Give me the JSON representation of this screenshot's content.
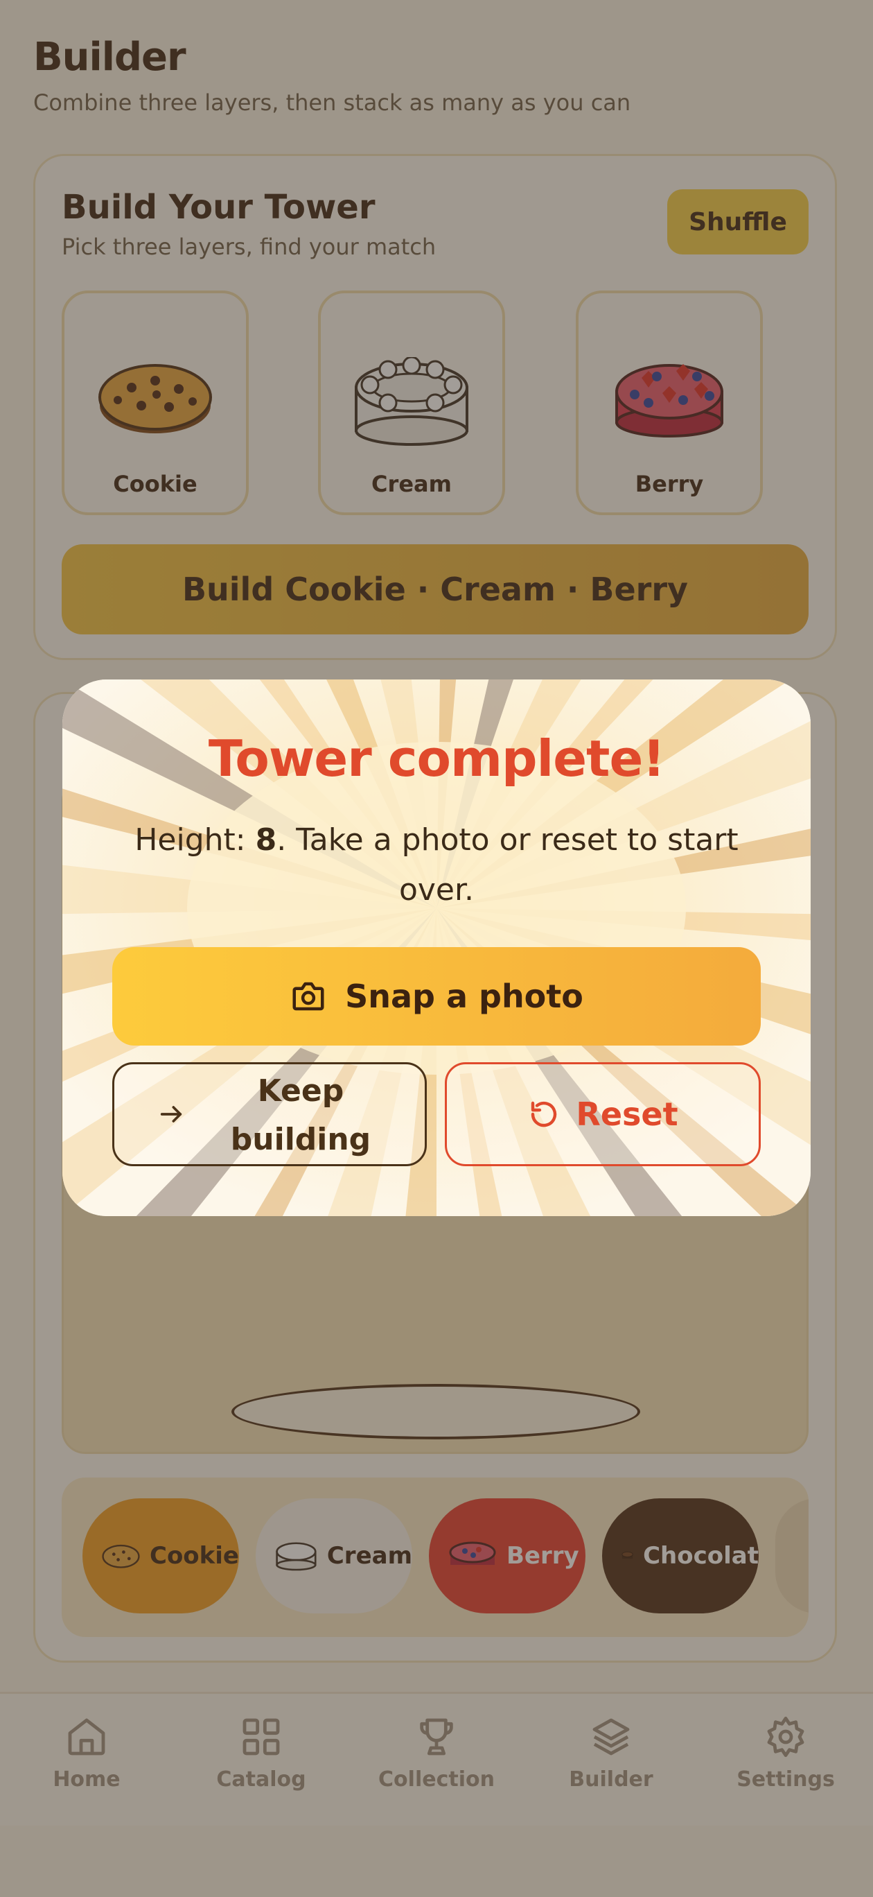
{
  "page": {
    "title": "Builder",
    "subtitle": "Combine three layers, then stack as many as you can"
  },
  "build_card": {
    "title": "Build Your Tower",
    "subtitle": "Pick three layers, find your match",
    "shuffle_label": "Shuffle",
    "layers": [
      {
        "label": "Cookie",
        "icon": "cookie-icon"
      },
      {
        "label": "Cream",
        "icon": "cream-icon"
      },
      {
        "label": "Berry",
        "icon": "berry-icon"
      }
    ],
    "build_label": "Build Cookie · Cream · Berry"
  },
  "chips": [
    {
      "label": "Cookie",
      "icon": "cookie-icon",
      "bg": "#ef9a1e",
      "fg": "#3b2210"
    },
    {
      "label": "Cream",
      "icon": "cream-icon",
      "bg": "#f6f1e8",
      "fg": "#3b2210"
    },
    {
      "label": "Berry",
      "icon": "berry-icon",
      "bg": "#e53b2d",
      "fg": "#ffffff"
    },
    {
      "label": "Chocolat",
      "icon": "chocolate-icon",
      "bg": "#4a2a14",
      "fg": "#ffffff"
    }
  ],
  "nav": [
    {
      "label": "Home",
      "icon": "home-icon"
    },
    {
      "label": "Catalog",
      "icon": "grid-icon"
    },
    {
      "label": "Collection",
      "icon": "trophy-icon"
    },
    {
      "label": "Builder",
      "icon": "layers-icon"
    },
    {
      "label": "Settings",
      "icon": "gear-icon"
    }
  ],
  "modal": {
    "title": "Tower complete!",
    "message_prefix": "Height: ",
    "height": "8",
    "message_suffix": ". Take a photo or reset to start over.",
    "snap_label": "Snap a photo",
    "keep_label": "Keep building",
    "reset_label": "Reset"
  },
  "colors": {
    "accent": "#f3cc45",
    "danger": "#e04a2c",
    "text": "#3b2210"
  }
}
